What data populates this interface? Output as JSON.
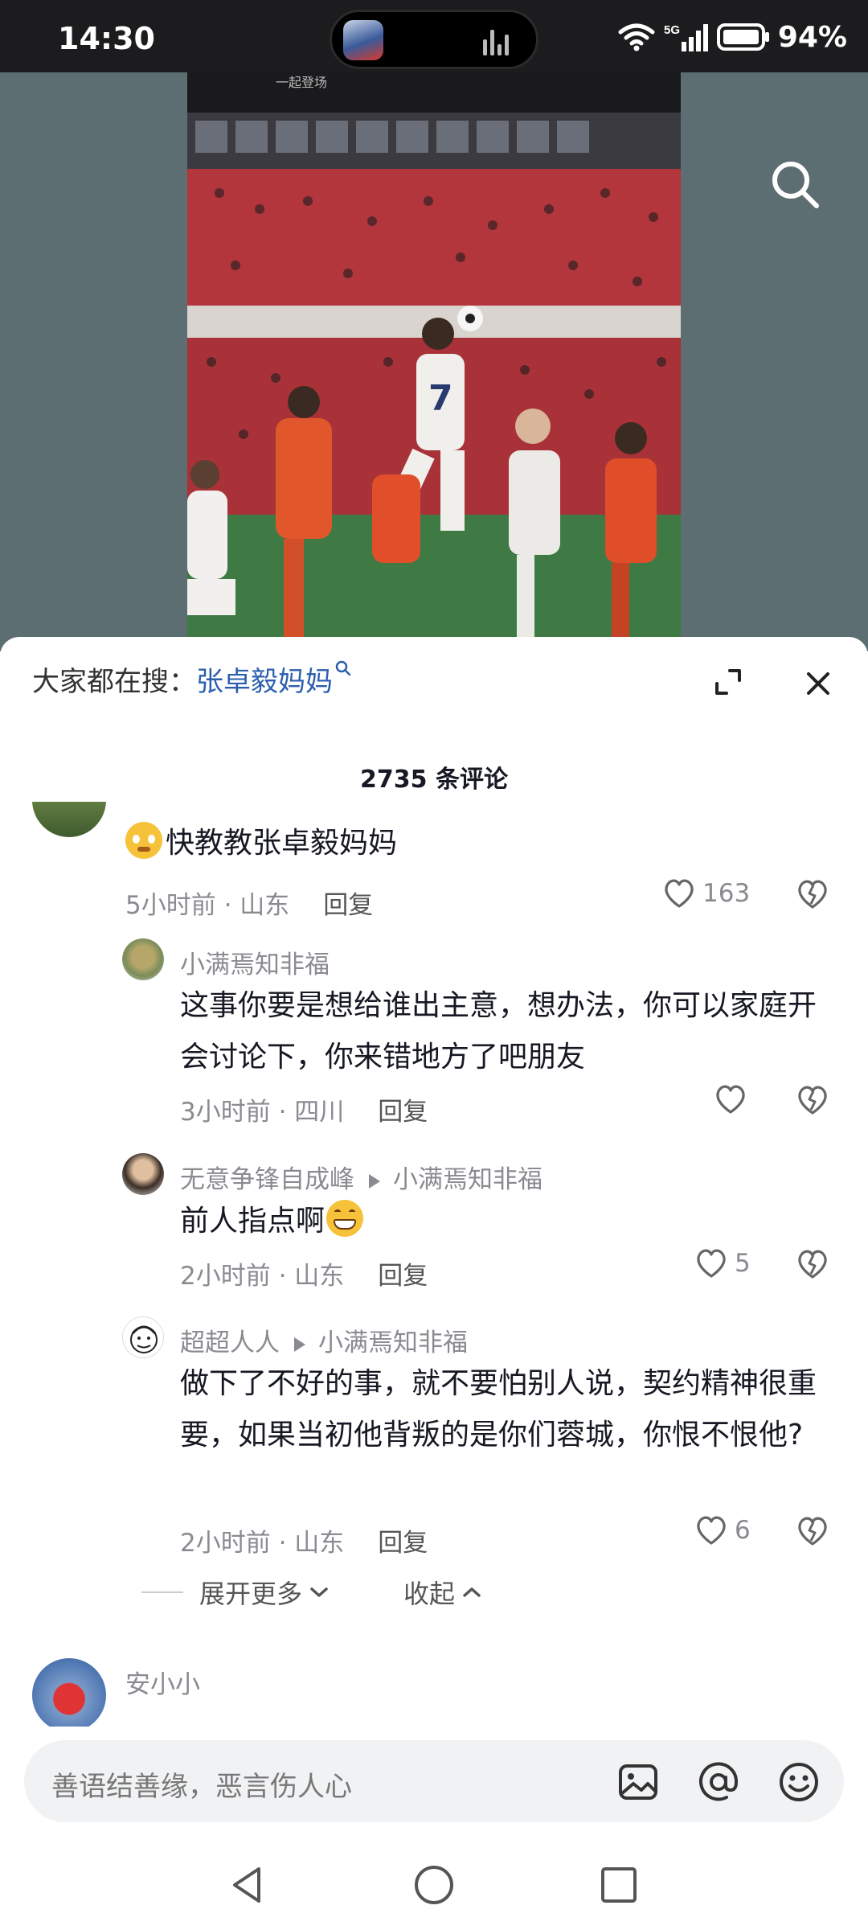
{
  "status_bar": {
    "time": "14:30",
    "battery": "94%",
    "network": "5G"
  },
  "video": {
    "banner_text": "一起登场",
    "search_icon": "search-icon"
  },
  "sheet": {
    "search_hint_label": "大家都在搜：",
    "search_hint_keyword": "张卓毅妈妈",
    "comment_count": "2735 条评论"
  },
  "comments": [
    {
      "name": "",
      "text": "快教教张卓毅妈妈",
      "time": "5小时前",
      "location": "山东",
      "reply": "回复",
      "likes": "163"
    },
    {
      "name": "小满焉知非福",
      "text": "这事你要是想给谁出主意，想办法，你可以家庭开会讨论下，你来错地方了吧朋友",
      "time": "3小时前",
      "location": "四川",
      "reply": "回复",
      "likes": ""
    },
    {
      "name": "无意争锋自成峰",
      "reply_to": "小满焉知非福",
      "text": "前人指点啊",
      "time": "2小时前",
      "location": "山东",
      "reply": "回复",
      "likes": "5"
    },
    {
      "name": "超超人人",
      "reply_to": "小满焉知非福",
      "text": "做下了不好的事，就不要怕别人说，契约精神很重要，如果当初他背叛的是你们蓉城，你恨不恨他?",
      "time": "2小时前",
      "location": "山东",
      "reply": "回复",
      "likes": "6"
    },
    {
      "name": "安小小",
      "text": "",
      "time": "",
      "location": "",
      "reply": "",
      "likes": ""
    }
  ],
  "thread_controls": {
    "expand_more": "展开更多",
    "collapse": "收起"
  },
  "input": {
    "placeholder": "善语结善缘，恶言伤人心"
  },
  "colors": {
    "accent_link": "#2b5fae",
    "secondary_text": "#8a8b91",
    "status_bar_bg": "#1c1c1e",
    "video_bg": "#5d6e72"
  }
}
